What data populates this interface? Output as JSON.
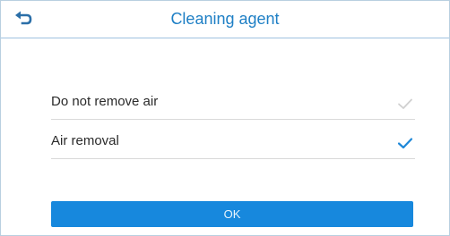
{
  "header": {
    "title": "Cleaning agent",
    "back_icon": "back-arrow-icon"
  },
  "options": [
    {
      "label": "Do not remove air",
      "selected": false
    },
    {
      "label": "Air removal",
      "selected": true
    }
  ],
  "footer": {
    "ok_label": "OK"
  },
  "colors": {
    "accent": "#1788dd",
    "title": "#1e7fc5",
    "check_selected": "#1e88d8",
    "check_unselected": "#d0d0d0"
  }
}
